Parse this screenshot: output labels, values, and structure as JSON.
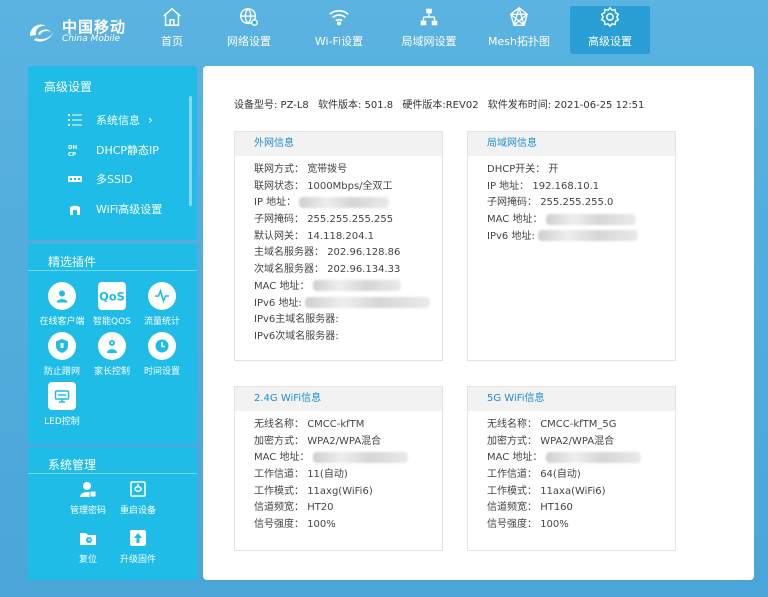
{
  "brand": {
    "name_cn": "中国移动",
    "name_en": "China Mobile"
  },
  "nav": [
    {
      "label": "首页",
      "icon": "home-icon"
    },
    {
      "label": "网络设置",
      "icon": "globe-gear-icon"
    },
    {
      "label": "Wi-Fi设置",
      "icon": "wifi-icon"
    },
    {
      "label": "局域网设置",
      "icon": "lan-icon"
    },
    {
      "label": "Mesh拓扑图",
      "icon": "mesh-icon"
    },
    {
      "label": "高级设置",
      "icon": "gear-icon",
      "active": true
    }
  ],
  "sidebar": {
    "advanced": {
      "title": "高级设置",
      "items": [
        {
          "label": "系统信息",
          "icon": "list-icon",
          "chevron": "›"
        },
        {
          "label": "DHCP静态IP",
          "icon": "dhcp-icon"
        },
        {
          "label": "多SSID",
          "icon": "ssid-icon"
        },
        {
          "label": "WiFi高级设置",
          "icon": "wifi-advanced-icon"
        }
      ]
    },
    "plugins": {
      "title": "精选插件",
      "items": [
        {
          "label": "在线客户端",
          "icon": "users-icon"
        },
        {
          "label": "智能QOS",
          "icon": "qos-icon",
          "badge": "QoS"
        },
        {
          "label": "流量统计",
          "icon": "pulse-icon"
        },
        {
          "label": "防止蹭网",
          "icon": "shield-icon"
        },
        {
          "label": "家长控制",
          "icon": "parent-icon"
        },
        {
          "label": "时间设置",
          "icon": "clock-icon"
        },
        {
          "label": "LED控制",
          "icon": "led-icon"
        }
      ]
    },
    "system": {
      "title": "系统管理",
      "items": [
        {
          "label": "管理密码",
          "icon": "lock-user-icon"
        },
        {
          "label": "重启设备",
          "icon": "restart-icon"
        },
        {
          "label": "复位",
          "icon": "folder-reset-icon"
        },
        {
          "label": "升级固件",
          "icon": "upload-icon"
        }
      ]
    }
  },
  "device": {
    "model": "设备型号: PZ-L8",
    "software": "软件版本: 501.8",
    "hardware": "硬件版本:REV02",
    "release": "软件发布时间: 2021-06-25 12:51"
  },
  "wan": {
    "title": "外网信息",
    "rows": [
      {
        "label": "联网方式：",
        "value": "宽带拨号"
      },
      {
        "label": "联网状态：",
        "value": "1000Mbps/全双工"
      },
      {
        "label": "IP 地址：",
        "value": "",
        "redacted": true
      },
      {
        "label": "子网掩码：",
        "value": "255.255.255.255"
      },
      {
        "label": "默认网关：",
        "value": "14.118.204.1"
      },
      {
        "label": "主域名服务器：",
        "value": "202.96.128.86"
      },
      {
        "label": "次域名服务器：",
        "value": "202.96.134.33"
      },
      {
        "label": "MAC 地址：",
        "value": "",
        "redacted": true
      },
      {
        "label": "IPv6 地址:",
        "value": "",
        "redacted": true
      },
      {
        "label": "IPv6主域名服务器:",
        "value": ""
      },
      {
        "label": "IPv6次域名服务器:",
        "value": ""
      }
    ]
  },
  "lan": {
    "title": "局域网信息",
    "rows": [
      {
        "label": "DHCP开关：",
        "value": "开"
      },
      {
        "label": "IP 地址：",
        "value": "192.168.10.1"
      },
      {
        "label": "子网掩码：",
        "value": "255.255.255.0"
      },
      {
        "label": "MAC 地址：",
        "value": "",
        "redacted": true
      },
      {
        "label": "IPv6 地址:",
        "value": "",
        "redacted": true
      }
    ]
  },
  "wifi24": {
    "title": "2.4G WiFi信息",
    "rows": [
      {
        "label": "无线名称：",
        "value": "CMCC-kfTM"
      },
      {
        "label": "加密方式：",
        "value": "WPA2/WPA混合"
      },
      {
        "label": "MAC 地址：",
        "value": "",
        "redacted": true
      },
      {
        "label": "工作信道：",
        "value": "11(自动)"
      },
      {
        "label": "工作模式：",
        "value": "11axg(WiFi6)"
      },
      {
        "label": "信道频宽：",
        "value": "HT20"
      },
      {
        "label": "信号强度：",
        "value": "100%"
      }
    ]
  },
  "wifi5": {
    "title": "5G WiFi信息",
    "rows": [
      {
        "label": "无线名称：",
        "value": "CMCC-kfTM_5G"
      },
      {
        "label": "加密方式：",
        "value": "WPA2/WPA混合"
      },
      {
        "label": "MAC 地址：",
        "value": "",
        "redacted": true
      },
      {
        "label": "工作信道：",
        "value": "64(自动)"
      },
      {
        "label": "工作模式：",
        "value": "11axa(WiFi6)"
      },
      {
        "label": "信道频宽：",
        "value": "HT160"
      },
      {
        "label": "信号强度：",
        "value": "100%"
      }
    ]
  }
}
